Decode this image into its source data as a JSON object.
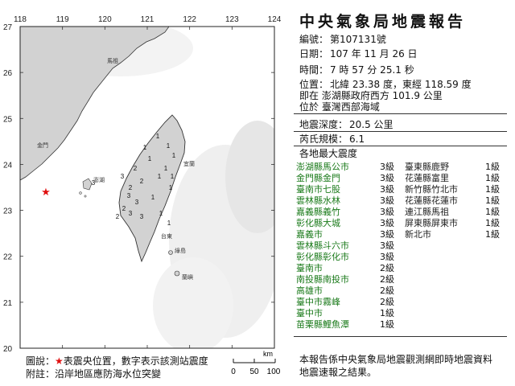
{
  "map": {
    "lon_ticks": [
      "118",
      "119",
      "120",
      "121",
      "122",
      "123",
      "124"
    ],
    "lat_ticks": [
      "27",
      "26",
      "25",
      "24",
      "23",
      "22",
      "21",
      "20"
    ],
    "epicenter_marker": "red-star-icon",
    "scale_unit": "km",
    "scale_ticks": [
      "0",
      "50",
      "100"
    ],
    "station_levels_on_map": [
      "1",
      "1",
      "1",
      "1",
      "1",
      "1",
      "1",
      "1",
      "1",
      "1",
      "2",
      "2",
      "2",
      "3",
      "3",
      "3",
      "1",
      "2",
      "1",
      "2",
      "3",
      "3",
      "3"
    ],
    "place_labels": [
      "馬祖",
      "金門",
      "澎湖",
      "宜蘭",
      "台東",
      "綠島",
      "蘭嶼"
    ],
    "colors": {
      "land": "#d2d2d2",
      "coast": "#333333",
      "star": "#e01010",
      "ocean_shading": "#eeeeee"
    }
  },
  "report": {
    "title": "中央氣象局地震報告",
    "number_label": "編號：",
    "number_value": "第107131號",
    "date_label": "日期：",
    "date_value": "107 年 11 月 26 日",
    "time_label": "時間：",
    "time_value": "7 時 57 分 25.1 秒",
    "position_label": "位置：",
    "position_value": "北緯 23.38 度，東經 118.59 度",
    "located_line": "即在 澎湖縣政府西方 101.9 公里",
    "area_line": "位於 臺灣西部海域",
    "depth_label": "地震深度：",
    "depth_value": "20.5 公里",
    "magnitude_label": "芮氏規模：",
    "magnitude_value": "6.1",
    "intensity_header": "各地最大震度",
    "left_stations": [
      {
        "name": "澎湖縣馬公市",
        "level": "3級"
      },
      {
        "name": "金門縣金門",
        "level": "3級"
      },
      {
        "name": "臺南市七股",
        "level": "3級"
      },
      {
        "name": "雲林縣水林",
        "level": "3級"
      },
      {
        "name": "嘉義縣義竹",
        "level": "3級"
      },
      {
        "name": "彰化縣大城",
        "level": "3級"
      },
      {
        "name": "嘉義市",
        "level": "3級"
      },
      {
        "name": "雲林縣斗六市",
        "level": "3級"
      },
      {
        "name": "彰化縣彰化市",
        "level": "3級"
      },
      {
        "name": "臺南市",
        "level": "2級"
      },
      {
        "name": "南投縣南投市",
        "level": "2級"
      },
      {
        "name": "高雄市",
        "level": "2級"
      },
      {
        "name": "臺中市霧峰",
        "level": "2級"
      },
      {
        "name": "臺中市",
        "level": "1級"
      },
      {
        "name": "苗栗縣鯉魚潭",
        "level": "1級"
      }
    ],
    "right_stations": [
      {
        "name": "臺東縣鹿野",
        "level": "1級"
      },
      {
        "name": "花蓮縣富里",
        "level": "1級"
      },
      {
        "name": "新竹縣竹北市",
        "level": "1級"
      },
      {
        "name": "花蓮縣花蓮市",
        "level": "1級"
      },
      {
        "name": "連江縣馬祖",
        "level": "1級"
      },
      {
        "name": "屏東縣屏東市",
        "level": "1級"
      },
      {
        "name": "新北市",
        "level": "1級"
      }
    ],
    "note_line1": "本報告係中央氣象局地震觀測網即時地震資料",
    "note_line2": "地震速報之結果。"
  },
  "legend": {
    "line1_prefix": "圖說：",
    "line1_star": "★",
    "line1_text": "表震央位置，數字表示該測站震度",
    "line2": "附註：沿岸地區應防海水位突變"
  }
}
